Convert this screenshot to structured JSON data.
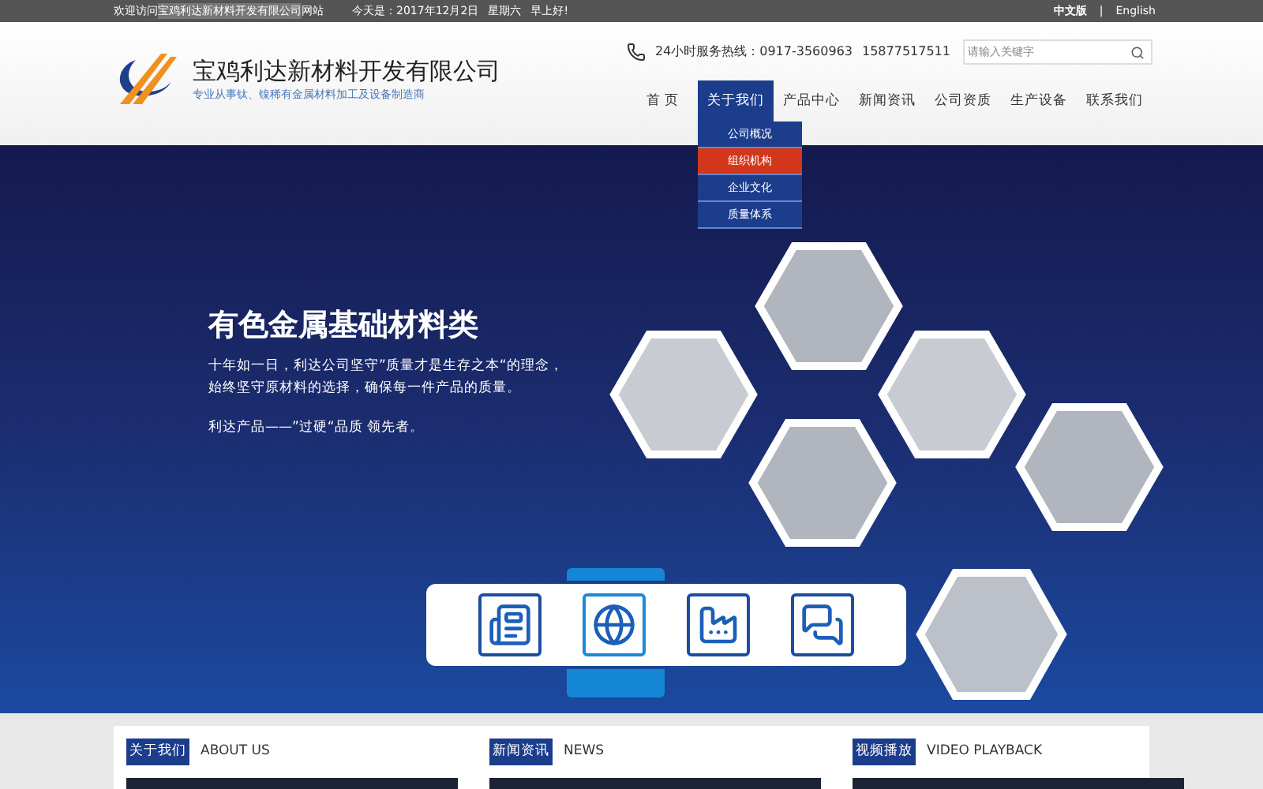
{
  "top_bar": {
    "welcome": "欢迎访问",
    "company_link": "宝鸡利达新材料开发有限公司",
    "suffix": "网站",
    "date": "今天是：2017年12月2日",
    "weekday": "星期六",
    "greeting": "早上好!",
    "languages": [
      {
        "label": "中文版",
        "selected": true
      },
      {
        "label": "English",
        "selected": false
      }
    ],
    "separator": "|"
  },
  "header": {
    "company_name": "宝鸡利达新材料开发有限公司",
    "slogan": "专业从事钛、镍稀有金属材料加工及设备制造商",
    "hotline": "24小时服务热线：0917-3560963",
    "phone2": "15877517511",
    "search": {
      "placeholder": "请输入关键字"
    }
  },
  "nav": [
    {
      "label": "首 页",
      "selected": false
    },
    {
      "label": "关于我们",
      "selected": true,
      "children": [
        {
          "label": "公司概况",
          "selected": false
        },
        {
          "label": "组织机构",
          "selected": true
        },
        {
          "label": "企业文化",
          "selected": false
        },
        {
          "label": "质量体系",
          "selected": false
        }
      ]
    },
    {
      "label": "产品中心",
      "selected": false
    },
    {
      "label": "新闻资讯",
      "selected": false
    },
    {
      "label": "公司资质",
      "selected": false
    },
    {
      "label": "生产设备",
      "selected": false
    },
    {
      "label": "联系我们",
      "selected": false
    }
  ],
  "banner": {
    "title": "有色金属基础材料类",
    "lines": [
      "十年如一日，利达公司坚守”质量才是生存之本“的理念，",
      "始终坚守原材料的选择，确保每一件产品的质量。"
    ],
    "tagline": "利达产品——”过硬“品质 领先者。"
  },
  "quick_links": [
    {
      "kind": "newspaper",
      "selected": false
    },
    {
      "kind": "globe",
      "selected": true
    },
    {
      "kind": "factory",
      "selected": false
    },
    {
      "kind": "chat",
      "selected": false
    }
  ],
  "sections": [
    {
      "tag": "关于我们",
      "title": "ABOUT US"
    },
    {
      "tag": "新闻资讯",
      "title": "NEWS"
    },
    {
      "tag": "视频播放",
      "title": "VIDEO PLAYBACK"
    }
  ]
}
